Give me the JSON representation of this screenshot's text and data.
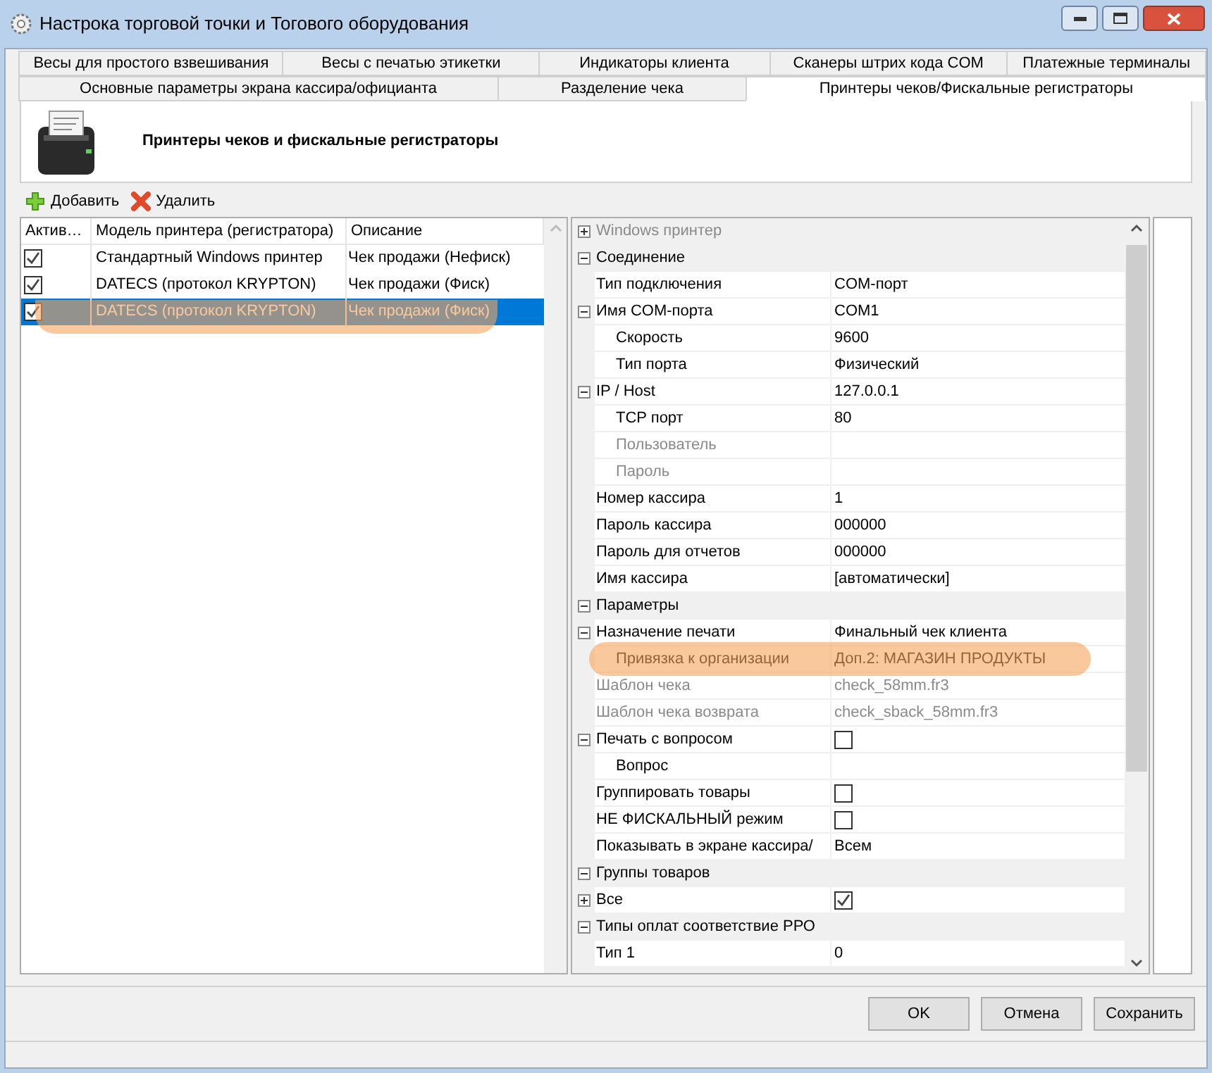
{
  "window": {
    "title": "Настрока торговой точки и Тогового оборудования"
  },
  "tab_rows": [
    [
      {
        "label": "Весы для простого взвешивания",
        "selected": false
      },
      {
        "label": "Весы с печатью этикетки",
        "selected": false
      },
      {
        "label": "Индикаторы клиента",
        "selected": false
      },
      {
        "label": "Сканеры штрих кода COM",
        "selected": false
      },
      {
        "label": "Платежные терминалы",
        "selected": false
      }
    ],
    [
      {
        "label": "Основные параметры экрана кассира/официанта",
        "selected": false
      },
      {
        "label": "Разделение чека",
        "selected": false
      },
      {
        "label": "Принтеры чеков/Фискальные регистраторы",
        "selected": true
      }
    ]
  ],
  "header": {
    "title": "Принтеры чеков и фискальные регистраторы"
  },
  "toolbar": [
    {
      "kind": "add",
      "label": "Добавить"
    },
    {
      "kind": "delete",
      "label": "Удалить"
    }
  ],
  "printers": {
    "columns": [
      "Актив…",
      "Модель принтера (регистратора)",
      "Описание"
    ],
    "rows": [
      {
        "checked": true,
        "model": "Стандартный Windows принтер",
        "description": "Чек продажи (Нефиск)",
        "selected": false,
        "highlighted": false
      },
      {
        "checked": true,
        "model": "DATECS (протокол KRYPTON)",
        "description": "Чек продажи (Фиск)",
        "selected": false,
        "highlighted": false
      },
      {
        "checked": true,
        "model": "DATECS (протокол KRYPTON)",
        "description": "Чек продажи (Фиск)",
        "selected": true,
        "highlighted": true
      }
    ]
  },
  "properties": [
    {
      "kind": "category",
      "label": "Windows принтер",
      "expanded": false,
      "disabled": true
    },
    {
      "kind": "category",
      "label": "Соединение",
      "expanded": true,
      "disabled": false,
      "children": [
        {
          "kind": "property",
          "label": "Тип подключения",
          "value": "COM-порт",
          "disabled": false
        },
        {
          "kind": "property",
          "label": "Имя COM-порта",
          "value": "COM1",
          "disabled": false,
          "expanded": true,
          "children": [
            {
              "kind": "property",
              "label": "Скорость",
              "value": "9600",
              "disabled": false
            },
            {
              "kind": "property",
              "label": "Тип порта",
              "value": "Физический",
              "disabled": false
            }
          ]
        },
        {
          "kind": "property",
          "label": "IP / Host",
          "value": "127.0.0.1",
          "disabled": false,
          "expanded": true,
          "children": [
            {
              "kind": "property",
              "label": "TCP порт",
              "value": "80",
              "disabled": false
            },
            {
              "kind": "property",
              "label": "Пользователь",
              "disabled": true
            },
            {
              "kind": "property",
              "label": "Пароль",
              "disabled": true
            }
          ]
        },
        {
          "kind": "property",
          "label": "Номер кассира",
          "value": "1",
          "disabled": false
        },
        {
          "kind": "property",
          "label": "Пароль кассира",
          "value": "000000",
          "disabled": false
        },
        {
          "kind": "property",
          "label": "Пароль для отчетов",
          "value": "000000",
          "disabled": false
        },
        {
          "kind": "property",
          "label": "Имя кассира",
          "value": "[автоматически]",
          "disabled": false
        }
      ]
    },
    {
      "kind": "category",
      "label": "Параметры",
      "expanded": true,
      "disabled": false,
      "children": [
        {
          "kind": "property",
          "label": "Назначение печати",
          "value": "Финальный чек клиента",
          "disabled": false,
          "expanded": true,
          "children": [
            {
              "kind": "property",
              "label": "Привязка к организации",
              "value": "Доп.2: МАГАЗИН ПРОДУКТЫ",
              "disabled": false,
              "highlighted": true
            }
          ]
        },
        {
          "kind": "property",
          "label": "Шаблон чека",
          "value": "check_58mm.fr3",
          "disabled": true
        },
        {
          "kind": "property",
          "label": "Шаблон чека возврата",
          "value": "check_sback_58mm.fr3",
          "disabled": true
        },
        {
          "kind": "checkbox",
          "label": "Печать с вопросом",
          "checked": false,
          "disabled": false,
          "expanded": true,
          "children": [
            {
              "kind": "property",
              "label": "Вопрос",
              "disabled": false
            }
          ]
        },
        {
          "kind": "checkbox",
          "label": "Группировать товары",
          "checked": false,
          "disabled": false
        },
        {
          "kind": "checkbox",
          "label": "НЕ ФИСКАЛЬНЫЙ режим",
          "checked": false,
          "disabled": false
        },
        {
          "kind": "property",
          "label": "Показывать в экране кассира/",
          "value": "Всем",
          "disabled": false
        }
      ]
    },
    {
      "kind": "category",
      "label": "Группы товаров",
      "expanded": true,
      "disabled": false,
      "children": [
        {
          "kind": "checkbox",
          "label": "Все",
          "checked": true,
          "disabled": false,
          "expanded": false
        }
      ]
    },
    {
      "kind": "category",
      "label": "Типы оплат соответствие РРО",
      "expanded": true,
      "disabled": false,
      "children": [
        {
          "kind": "property",
          "label": "Тип 1",
          "value": "0",
          "disabled": false
        }
      ]
    }
  ],
  "buttons": [
    "OK",
    "Отмена",
    "Сохранить"
  ]
}
